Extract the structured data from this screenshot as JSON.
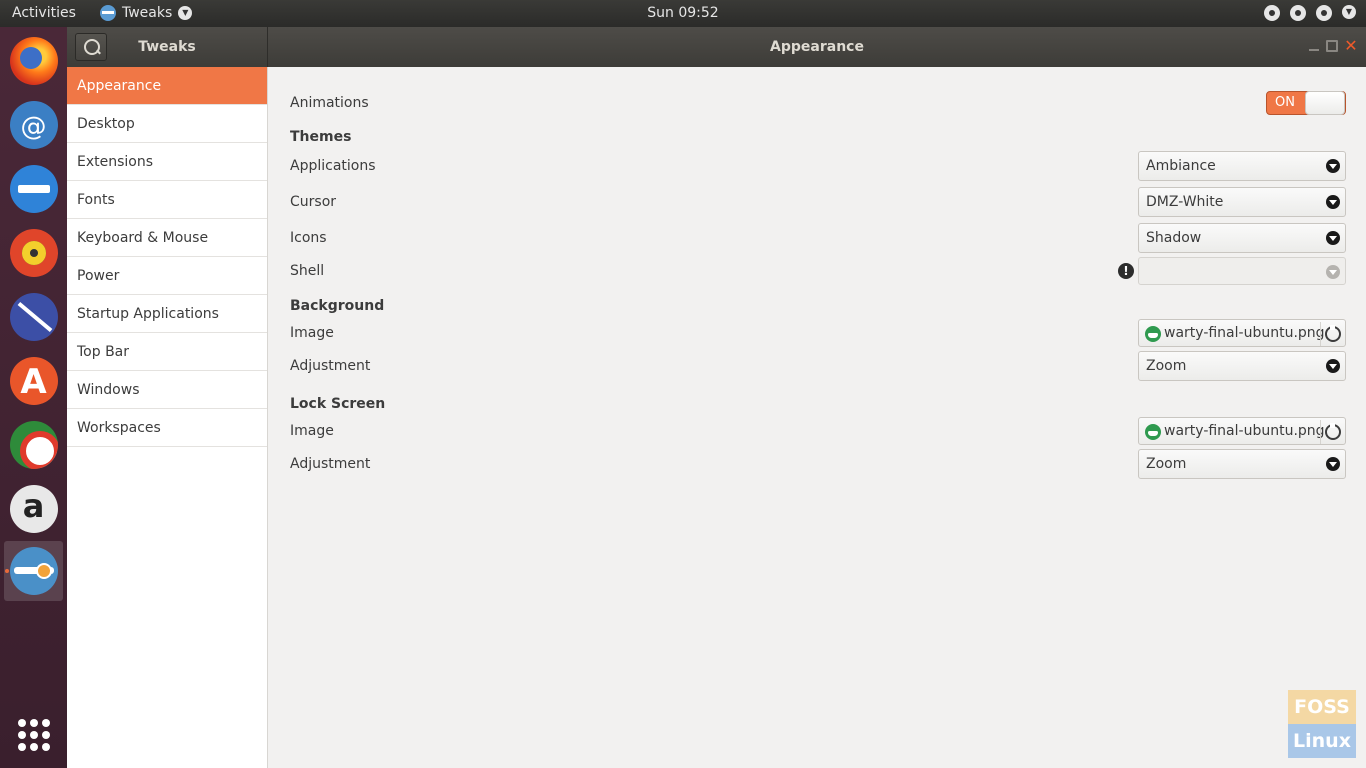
{
  "topbar": {
    "activities": "Activities",
    "app_name": "Tweaks",
    "clock": "Sun 09:52",
    "tray_icons": [
      "network-icon",
      "accessibility-icon",
      "volume-icon",
      "power-menu-icon"
    ]
  },
  "dock": {
    "items": [
      {
        "name": "firefox",
        "icon": "firefox-icon"
      },
      {
        "name": "thunderbird",
        "icon": "mail-icon"
      },
      {
        "name": "files",
        "icon": "files-icon"
      },
      {
        "name": "rhythmbox",
        "icon": "rhythmbox-icon"
      },
      {
        "name": "libreoffice-writer",
        "icon": "writer-icon"
      },
      {
        "name": "ubuntu-software",
        "icon": "software-store-icon"
      },
      {
        "name": "help",
        "icon": "help-icon"
      },
      {
        "name": "amazon",
        "icon": "amazon-icon"
      },
      {
        "name": "tweaks",
        "icon": "tweaks-icon",
        "active": true
      }
    ],
    "show_apps": "show-applications-icon"
  },
  "window": {
    "sidebar_title": "Tweaks",
    "title": "Appearance",
    "sidebar": [
      {
        "label": "Appearance",
        "selected": true
      },
      {
        "label": "Desktop"
      },
      {
        "label": "Extensions"
      },
      {
        "label": "Fonts"
      },
      {
        "label": "Keyboard & Mouse"
      },
      {
        "label": "Power"
      },
      {
        "label": "Startup Applications"
      },
      {
        "label": "Top Bar"
      },
      {
        "label": "Windows"
      },
      {
        "label": "Workspaces"
      }
    ]
  },
  "content": {
    "animations": {
      "label": "Animations",
      "switch": "ON"
    },
    "themes": {
      "heading": "Themes",
      "applications": {
        "label": "Applications",
        "value": "Ambiance"
      },
      "cursor": {
        "label": "Cursor",
        "value": "DMZ-White"
      },
      "icons": {
        "label": "Icons",
        "value": "Shadow"
      },
      "shell": {
        "label": "Shell",
        "value": ""
      }
    },
    "background": {
      "heading": "Background",
      "image": {
        "label": "Image",
        "value": "warty-final-ubuntu.png"
      },
      "adjustment": {
        "label": "Adjustment",
        "value": "Zoom"
      }
    },
    "lock_screen": {
      "heading": "Lock Screen",
      "image": {
        "label": "Image",
        "value": "warty-final-ubuntu.png"
      },
      "adjustment": {
        "label": "Adjustment",
        "value": "Zoom"
      }
    }
  },
  "watermark": {
    "line1": "FOSS",
    "line2": "Linux"
  },
  "colors": {
    "accent": "#f07746",
    "headerbar": "#3d3c38",
    "dock": "#4a2838"
  }
}
